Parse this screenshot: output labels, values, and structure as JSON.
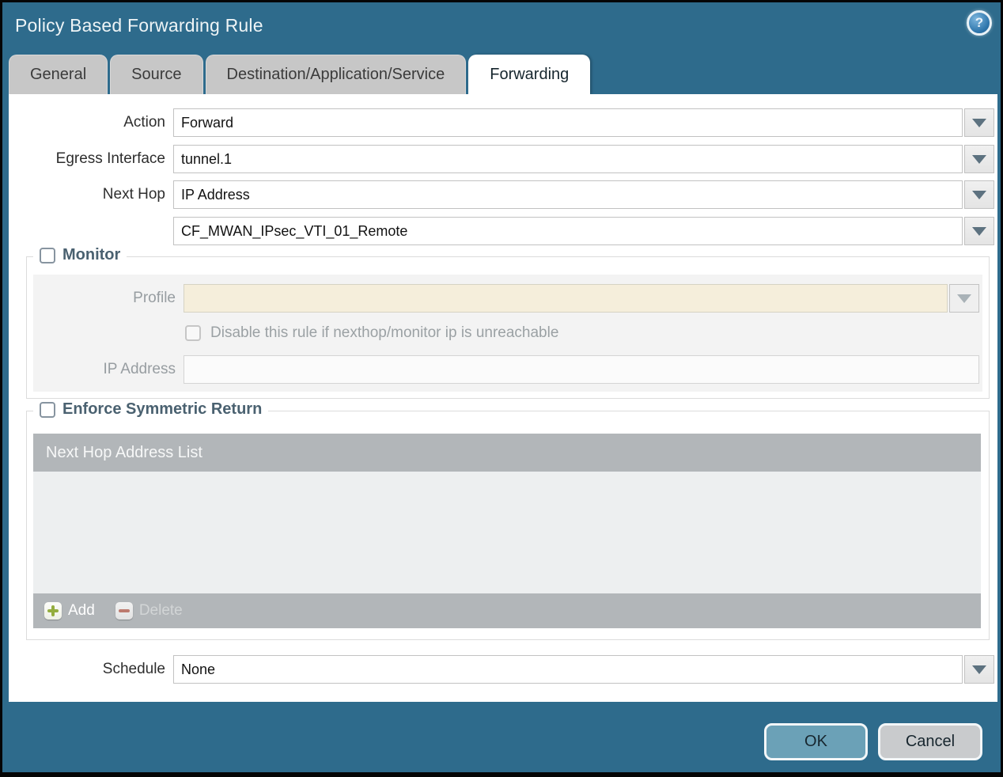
{
  "dialog": {
    "title": "Policy Based Forwarding Rule",
    "help_glyph": "?"
  },
  "tabs": [
    {
      "label": "General",
      "active": false
    },
    {
      "label": "Source",
      "active": false
    },
    {
      "label": "Destination/Application/Service",
      "active": false
    },
    {
      "label": "Forwarding",
      "active": true
    }
  ],
  "form": {
    "action": {
      "label": "Action",
      "value": "Forward"
    },
    "egress_interface": {
      "label": "Egress Interface",
      "value": "tunnel.1"
    },
    "next_hop": {
      "label": "Next Hop",
      "value": "IP Address"
    },
    "next_hop_address": {
      "value": "CF_MWAN_IPsec_VTI_01_Remote"
    },
    "schedule": {
      "label": "Schedule",
      "value": "None"
    }
  },
  "monitor": {
    "label": "Monitor",
    "checked": false,
    "profile": {
      "label": "Profile",
      "value": ""
    },
    "disable_rule": {
      "label": "Disable this rule if nexthop/monitor ip is unreachable",
      "checked": false
    },
    "ip_address": {
      "label": "IP Address",
      "value": ""
    }
  },
  "enforce_symmetric_return": {
    "label": "Enforce Symmetric Return",
    "checked": false,
    "table": {
      "header": "Next Hop Address List",
      "rows": [],
      "add_label": "Add",
      "delete_label": "Delete"
    }
  },
  "footer": {
    "ok_label": "OK",
    "cancel_label": "Cancel"
  },
  "colors": {
    "background_teal": "#2e6b8c",
    "active_tab": "#ffffff",
    "inactive_tab": "#c7c7c7",
    "section_title": "#4a6170",
    "disabled_field_beige": "#f5eedb",
    "table_header_gray": "#b2b6b9",
    "ok_button": "#6ba1b7",
    "cancel_button": "#c9cbcd",
    "add_icon_green": "#94ad3e",
    "delete_icon_red": "#bd7a6e"
  }
}
